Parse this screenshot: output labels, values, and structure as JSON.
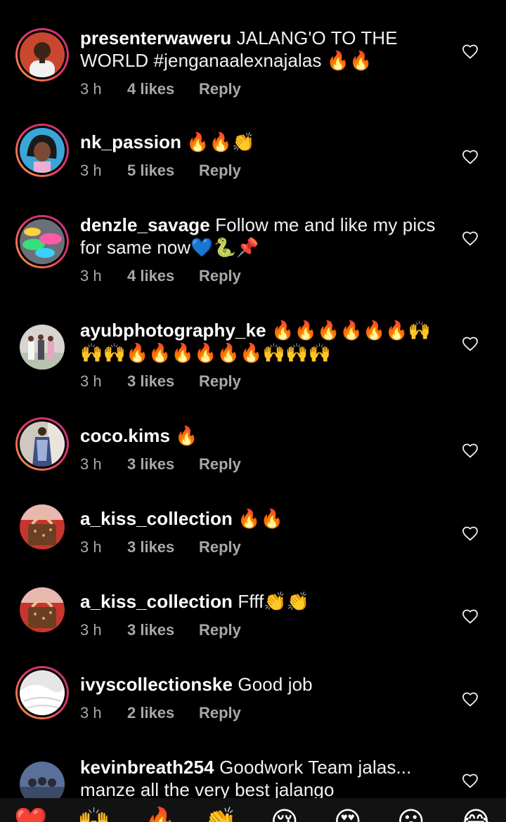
{
  "comments": [
    {
      "username": "presenterwaweru",
      "text": "JALANG'O TO THE WORLD #jenganaalexnajalas 🔥🔥",
      "time": "3 h",
      "likes": "4 likes",
      "reply": "Reply",
      "story_ring": true,
      "avatar_icon": "man-portrait-icon"
    },
    {
      "username": "nk_passion",
      "text": "🔥🔥👏",
      "time": "3 h",
      "likes": "5 likes",
      "reply": "Reply",
      "story_ring": true,
      "avatar_icon": "woman-portrait-icon"
    },
    {
      "username": "denzle_savage",
      "text": "Follow me and like my pics for same now💙🐍📌",
      "time": "3 h",
      "likes": "4 likes",
      "reply": "Reply",
      "story_ring": true,
      "avatar_icon": "shoes-photo-icon"
    },
    {
      "username": "ayubphotography_ke",
      "text": "🔥🔥🔥🔥🔥🔥🙌🙌🙌🔥🔥🔥🔥🔥🔥🙌🙌🙌",
      "time": "3 h",
      "likes": "3 likes",
      "reply": "Reply",
      "story_ring": false,
      "avatar_icon": "wedding-photo-icon"
    },
    {
      "username": "coco.kims",
      "text": "🔥",
      "time": "3 h",
      "likes": "3 likes",
      "reply": "Reply",
      "story_ring": true,
      "avatar_icon": "fashion-photo-icon"
    },
    {
      "username": "a_kiss_collection",
      "text": "🔥🔥",
      "time": "3 h",
      "likes": "3 likes",
      "reply": "Reply",
      "story_ring": false,
      "avatar_icon": "handbag-photo-icon"
    },
    {
      "username": "a_kiss_collection",
      "text": "Ffff👏👏",
      "time": "3 h",
      "likes": "3 likes",
      "reply": "Reply",
      "story_ring": false,
      "avatar_icon": "handbag-photo-icon"
    },
    {
      "username": "ivyscollectionske",
      "text": "Good job",
      "time": "3 h",
      "likes": "2 likes",
      "reply": "Reply",
      "story_ring": true,
      "avatar_icon": "bedding-photo-icon"
    },
    {
      "username": "kevinbreath254",
      "text": "Goodwork Team jalas... manze all the very best jalango",
      "time": "",
      "likes": "",
      "reply": "",
      "story_ring": false,
      "avatar_icon": "group-photo-icon"
    }
  ],
  "emoji_bar": [
    "❤️",
    "🙌",
    "🔥",
    "👏",
    "😢",
    "😍",
    "😮",
    "😂"
  ],
  "colors": {
    "background": "#000000",
    "meta": "#a8a8a8",
    "ring_start": "#f9a23a",
    "ring_end": "#c13584"
  }
}
